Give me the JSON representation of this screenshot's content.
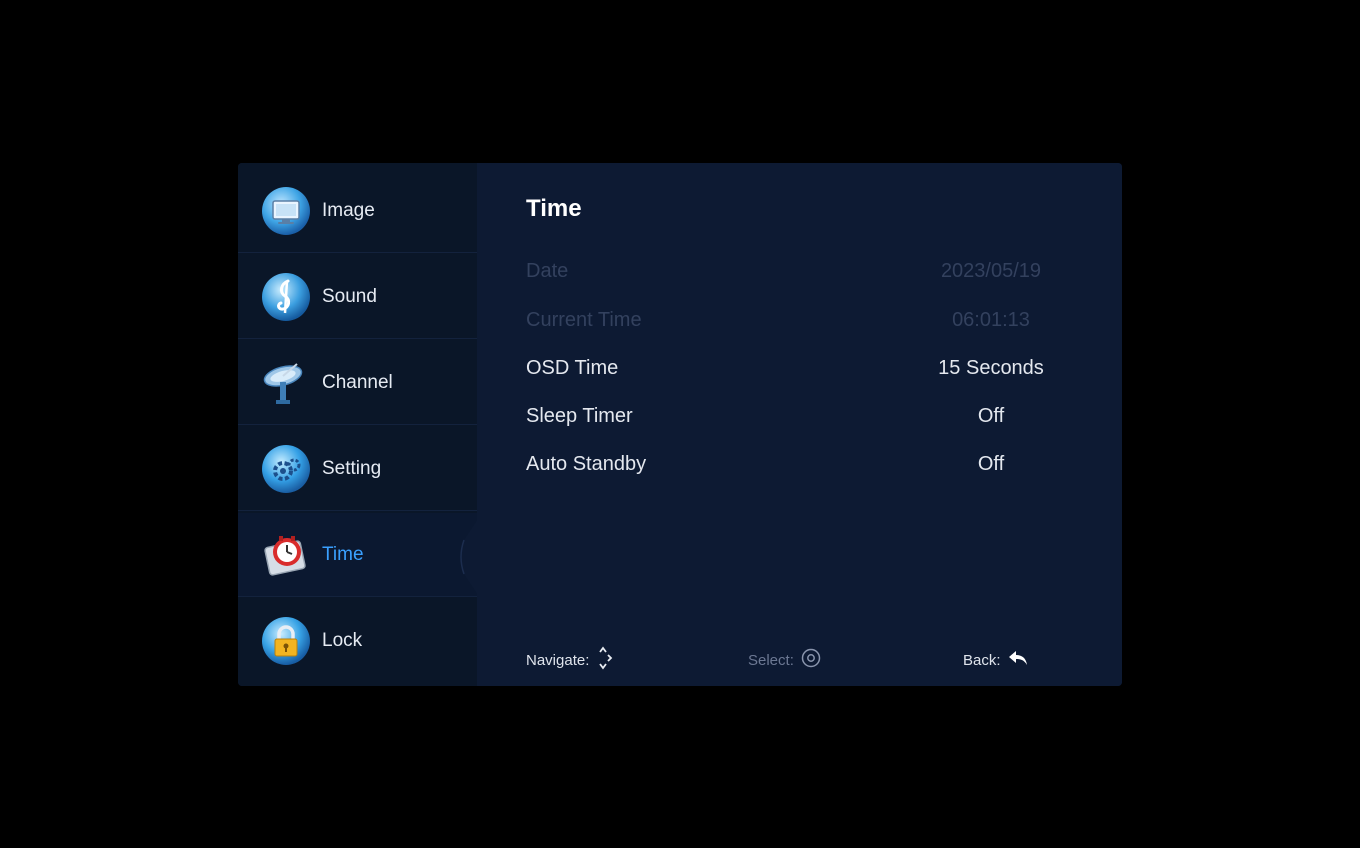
{
  "sidebar": {
    "items": [
      {
        "label": "Image",
        "icon": "image-icon",
        "active": false
      },
      {
        "label": "Sound",
        "icon": "music-note-icon",
        "active": false
      },
      {
        "label": "Channel",
        "icon": "satellite-dish-icon",
        "active": false
      },
      {
        "label": "Setting",
        "icon": "gear-icon",
        "active": false
      },
      {
        "label": "Time",
        "icon": "clock-icon",
        "active": true
      },
      {
        "label": "Lock",
        "icon": "lock-icon",
        "active": false
      }
    ],
    "active_color": "#3aa0ff"
  },
  "content": {
    "title": "Time",
    "rows": [
      {
        "name": "Date",
        "value": "2023/05/19",
        "enabled": false
      },
      {
        "name": "Current Time",
        "value": "06:01:13",
        "enabled": false
      },
      {
        "name": "OSD Time",
        "value": "15 Seconds",
        "enabled": true
      },
      {
        "name": "Sleep Timer",
        "value": "Off",
        "enabled": true
      },
      {
        "name": "Auto Standby",
        "value": "Off",
        "enabled": true
      }
    ]
  },
  "footer": {
    "navigate_label": "Navigate:",
    "select_label": "Select:",
    "back_label": "Back:"
  }
}
